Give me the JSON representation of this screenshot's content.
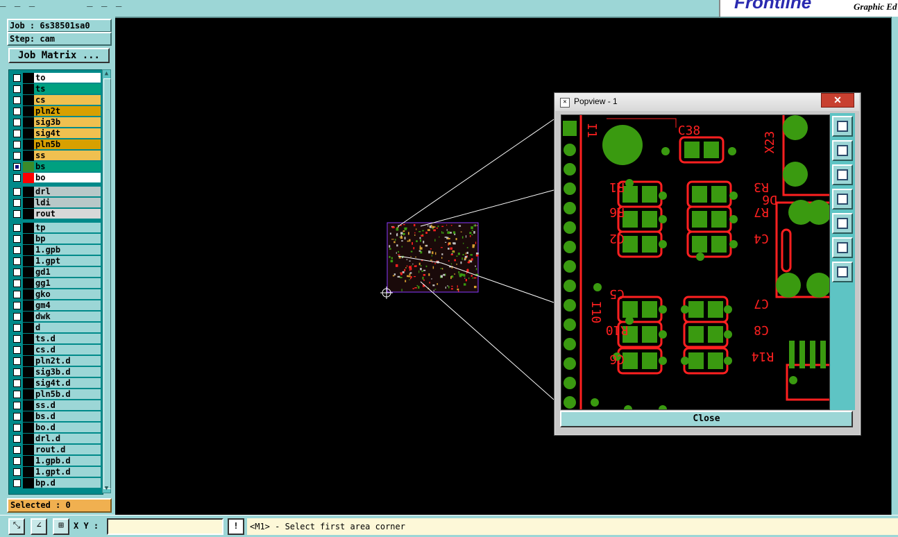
{
  "header": {
    "menu_hint": "_ _ _ ‾ ‾ ‾ _ _ _",
    "brand": "Frontline",
    "brand_sub": "Graphic Ed"
  },
  "job": {
    "job_label": "Job : 6s38501sa0",
    "step_label": "Step: cam",
    "matrix_button": "Job Matrix ..."
  },
  "layers": [
    {
      "name": "to",
      "color": "#ffffff",
      "swatch": "#000000",
      "checked": false
    },
    {
      "name": "ts",
      "color": "#00a080",
      "swatch": "#000000",
      "checked": false
    },
    {
      "name": "cs",
      "color": "#f0c050",
      "swatch": "#000000",
      "checked": false
    },
    {
      "name": "pln2t",
      "color": "#d8a000",
      "swatch": "#000000",
      "checked": false
    },
    {
      "name": "sig3b",
      "color": "#f0c050",
      "swatch": "#000000",
      "checked": false
    },
    {
      "name": "sig4t",
      "color": "#f0c050",
      "swatch": "#000000",
      "checked": false
    },
    {
      "name": "pln5b",
      "color": "#d8a000",
      "swatch": "#000000",
      "checked": false
    },
    {
      "name": "ss",
      "color": "#f0c050",
      "swatch": "#000000",
      "checked": false
    },
    {
      "name": "bs",
      "color": "#00a080",
      "swatch": "#3a8a2a",
      "checked": true
    },
    {
      "name": "bo",
      "color": "#ffffff",
      "swatch": "#ff0000",
      "checked": false
    },
    {
      "name": "drl",
      "color": "#b8c8c8",
      "swatch": "#000000",
      "checked": false
    },
    {
      "name": "ldi",
      "color": "#b8c8c8",
      "swatch": "#000000",
      "checked": false
    },
    {
      "name": "rout",
      "color": "#d8d8d8",
      "swatch": "#000000",
      "checked": false
    },
    {
      "name": "tp",
      "color": "#9cd6d6",
      "swatch": "#000000",
      "checked": false
    },
    {
      "name": "bp",
      "color": "#9cd6d6",
      "swatch": "#000000",
      "checked": false
    },
    {
      "name": "1.gpb",
      "color": "#9cd6d6",
      "swatch": "#000000",
      "checked": false
    },
    {
      "name": "1.gpt",
      "color": "#9cd6d6",
      "swatch": "#000000",
      "checked": false
    },
    {
      "name": "gd1",
      "color": "#9cd6d6",
      "swatch": "#000000",
      "checked": false
    },
    {
      "name": "gg1",
      "color": "#9cd6d6",
      "swatch": "#000000",
      "checked": false
    },
    {
      "name": "gko",
      "color": "#9cd6d6",
      "swatch": "#000000",
      "checked": false
    },
    {
      "name": "gm4",
      "color": "#9cd6d6",
      "swatch": "#000000",
      "checked": false
    },
    {
      "name": "dwk",
      "color": "#9cd6d6",
      "swatch": "#000000",
      "checked": false
    },
    {
      "name": "d",
      "color": "#9cd6d6",
      "swatch": "#000000",
      "checked": false
    },
    {
      "name": "ts.d",
      "color": "#9cd6d6",
      "swatch": "#000000",
      "checked": false
    },
    {
      "name": "cs.d",
      "color": "#9cd6d6",
      "swatch": "#000000",
      "checked": false
    },
    {
      "name": "pln2t.d",
      "color": "#9cd6d6",
      "swatch": "#000000",
      "checked": false
    },
    {
      "name": "sig3b.d",
      "color": "#9cd6d6",
      "swatch": "#000000",
      "checked": false
    },
    {
      "name": "sig4t.d",
      "color": "#9cd6d6",
      "swatch": "#000000",
      "checked": false
    },
    {
      "name": "pln5b.d",
      "color": "#9cd6d6",
      "swatch": "#000000",
      "checked": false
    },
    {
      "name": "ss.d",
      "color": "#9cd6d6",
      "swatch": "#000000",
      "checked": false
    },
    {
      "name": "bs.d",
      "color": "#9cd6d6",
      "swatch": "#000000",
      "checked": false
    },
    {
      "name": "bo.d",
      "color": "#9cd6d6",
      "swatch": "#000000",
      "checked": false
    },
    {
      "name": "drl.d",
      "color": "#9cd6d6",
      "swatch": "#000000",
      "checked": false
    },
    {
      "name": "rout.d",
      "color": "#9cd6d6",
      "swatch": "#000000",
      "checked": false
    },
    {
      "name": "1.gpb.d",
      "color": "#9cd6d6",
      "swatch": "#000000",
      "checked": false
    },
    {
      "name": "1.gpt.d",
      "color": "#9cd6d6",
      "swatch": "#000000",
      "checked": false
    },
    {
      "name": "bp.d",
      "color": "#9cd6d6",
      "swatch": "#000000",
      "checked": false
    }
  ],
  "selected_label": "Selected : 0",
  "bottom": {
    "xy_label": "X Y :",
    "xy_value": "",
    "message_icon": "!",
    "status_message": "<M1> - Select first area corner"
  },
  "popview": {
    "title": "Popview - 1",
    "close_button": "Close",
    "tools": [
      "fit-icon",
      "zoom-up-icon",
      "zoom-down-icon",
      "pan-left-icon",
      "pan-right-icon",
      "zoom-in-icon",
      "zoom-out-icon"
    ],
    "silkscreen_labels": [
      "C38",
      "X23",
      "R1",
      "R3",
      "D6",
      "R6",
      "R7",
      "C2",
      "C4",
      "C5",
      "C7",
      "I10",
      "R10",
      "C8",
      "C6",
      "R14",
      "I1"
    ]
  },
  "colors": {
    "panel": "#9cd6d6",
    "pad": "#3a9a10",
    "outline": "#ff2020",
    "selected_bg": "#f0b050"
  }
}
